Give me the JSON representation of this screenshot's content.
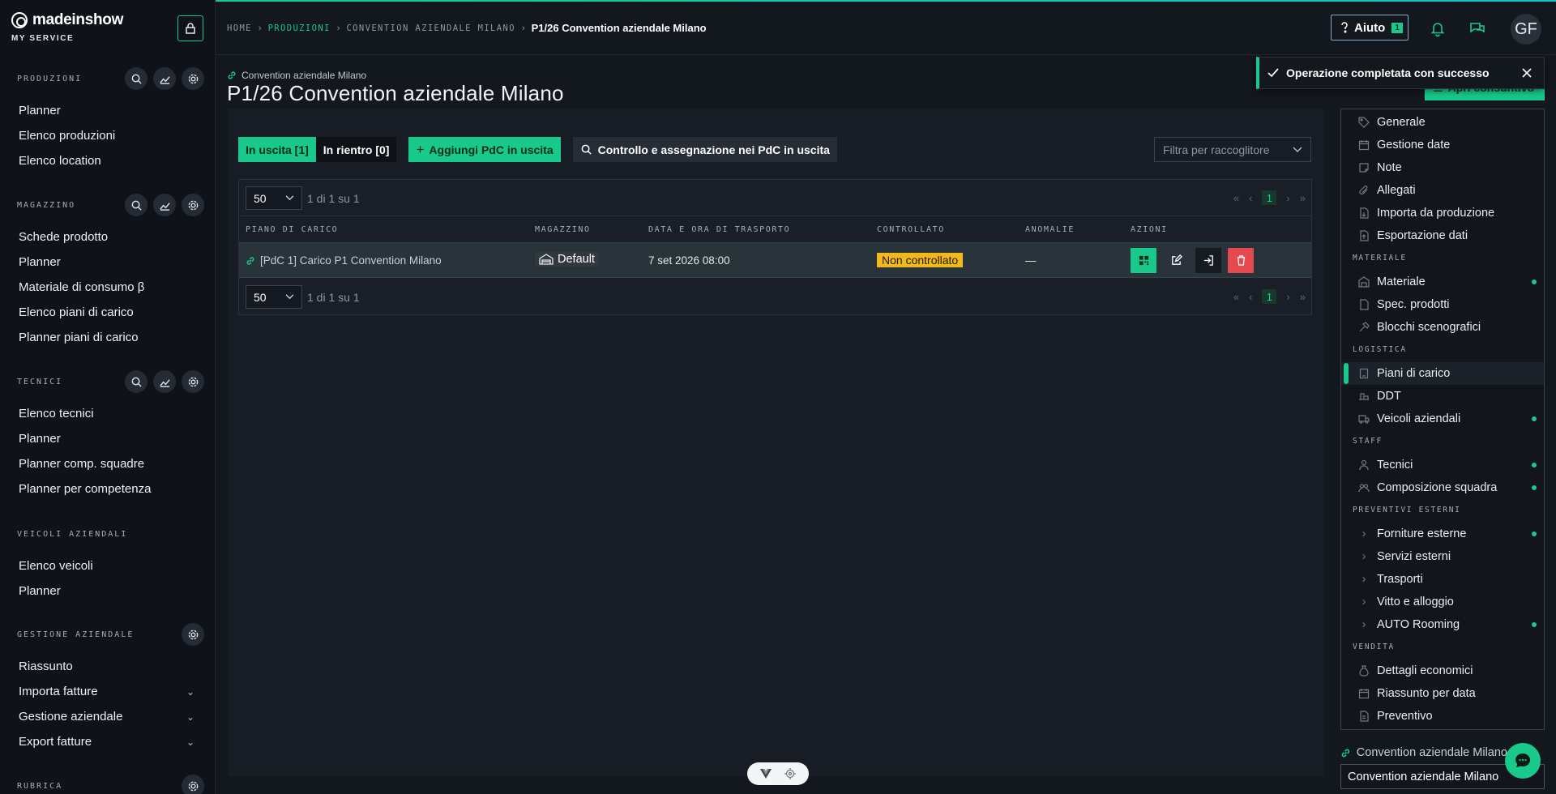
{
  "brand": {
    "name": "madeinshow",
    "subtitle": "MY SERVICE"
  },
  "sidebar": {
    "sections": [
      {
        "title": "PRODUZIONI",
        "items": [
          "Planner",
          "Elenco produzioni",
          "Elenco location"
        ]
      },
      {
        "title": "MAGAZZINO",
        "items": [
          "Schede prodotto",
          "Planner",
          "Materiale di consumo β",
          "Elenco piani di carico",
          "Planner piani di carico"
        ]
      },
      {
        "title": "TECNICI",
        "items": [
          "Elenco tecnici",
          "Planner",
          "Planner comp. squadre",
          "Planner per competenza"
        ]
      },
      {
        "title": "VEICOLI AZIENDALI",
        "items": [
          "Elenco veicoli",
          "Planner"
        ]
      },
      {
        "title": "GESTIONE AZIENDALE",
        "items": [
          "Riassunto",
          "Importa fatture",
          "Gestione aziendale",
          "Export fatture"
        ]
      },
      {
        "title": "RUBRICA",
        "items": []
      }
    ]
  },
  "header": {
    "breadcrumb": [
      "HOME",
      "PRODUZIONI",
      "CONVENTION AZIENDALE MILANO"
    ],
    "current": "P1/26 Convention aziendale Milano",
    "help_label": "Aiuto",
    "help_badge": "1",
    "avatar": "GF"
  },
  "page": {
    "subtitle": "Convention aziendale Milano",
    "title": "P1/26 Convention aziendale Milano"
  },
  "toolbar": {
    "tab_out": "In uscita [1]",
    "tab_in": "In rientro [0]",
    "add_label": "Aggiungi PdC in uscita",
    "check_label": "Controllo e assegnazione nei PdC in uscita",
    "filter_placeholder": "Filtra per raccoglitore"
  },
  "table": {
    "page_size": "50",
    "count_label": "1 di 1 su 1",
    "current_page": "1",
    "columns": [
      "PIANO DI CARICO",
      "MAGAZZINO",
      "DATA E ORA DI TRASPORTO",
      "CONTROLLATO",
      "ANOMALIE",
      "AZIONI"
    ],
    "rows": [
      {
        "piano": "[PdC 1] Carico P1 Convention Milano",
        "magazzino": "Default",
        "data": "7 set 2026 08:00",
        "controllato": "Non controllato",
        "anomalie": "—"
      }
    ]
  },
  "side_menu": {
    "open_button": "Apri consuntivo",
    "groups": {
      "materiale": "MATERIALE",
      "logistica": "LOGISTICA",
      "staff": "STAFF",
      "preventivi": "PREVENTIVI ESTERNI",
      "vendita": "VENDITA"
    },
    "items": {
      "generale": "Generale",
      "gestione_date": "Gestione date",
      "note": "Note",
      "allegati": "Allegati",
      "importa": "Importa da produzione",
      "esportazione": "Esportazione dati",
      "materiale": "Materiale",
      "spec": "Spec. prodotti",
      "blocchi": "Blocchi scenografici",
      "piani": "Piani di carico",
      "ddt": "DDT",
      "veicoli": "Veicoli aziendali",
      "tecnici": "Tecnici",
      "composizione": "Composizione squadra",
      "forniture": "Forniture esterne",
      "servizi": "Servizi esterni",
      "trasporti": "Trasporti",
      "vitto": "Vitto e alloggio",
      "rooming": "AUTO Rooming",
      "dettagli": "Dettagli economici",
      "riassunto": "Riassunto per data",
      "preventivo": "Preventivo"
    }
  },
  "toast": {
    "message": "Operazione completata con successo"
  },
  "footer": {
    "production_link": "Convention aziendale Milano",
    "production_select": "Convention aziendale Milano"
  },
  "colors": {
    "accent": "#18c98b",
    "warning": "#f2b91c",
    "danger": "#e5484d",
    "background": "#13171e"
  }
}
